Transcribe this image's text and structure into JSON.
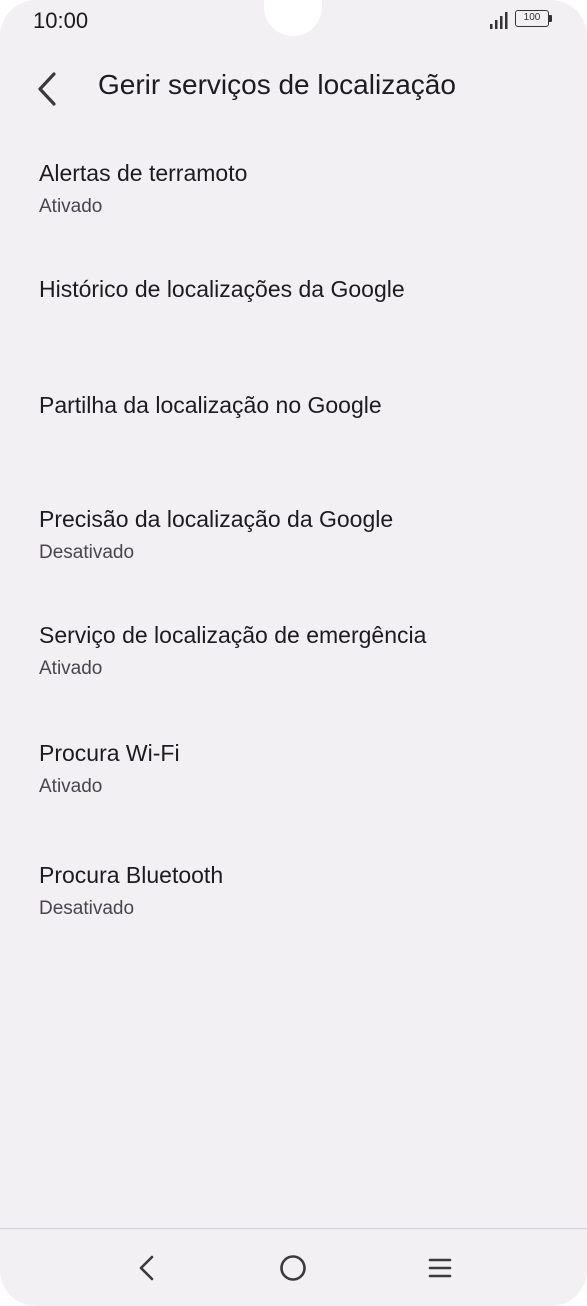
{
  "status_bar": {
    "time": "10:00",
    "battery_level": "100",
    "signal_icon": "signal-bars-icon",
    "battery_icon": "battery-icon"
  },
  "header": {
    "title": "Gerir serviços de localização",
    "back_icon": "chevron-left-icon"
  },
  "settings": [
    {
      "title": "Alertas de terramoto",
      "summary": "Ativado"
    },
    {
      "title": "Histórico de localizações da Google",
      "summary": ""
    },
    {
      "title": "Partilha da localização no Google",
      "summary": ""
    },
    {
      "title": "Precisão da localização da Google",
      "summary": "Desativado"
    },
    {
      "title": "Serviço de localização de emergência",
      "summary": "Ativado"
    },
    {
      "title": "Procura Wi-Fi",
      "summary": "Ativado"
    },
    {
      "title": "Procura Bluetooth",
      "summary": "Desativado"
    }
  ],
  "nav_bar": {
    "back_icon": "nav-back-icon",
    "home_icon": "nav-home-icon",
    "recents_icon": "nav-menu-icon"
  },
  "colors": {
    "background": "#f2f0f3",
    "text_primary": "#1c1b1f",
    "text_secondary": "#49454f"
  }
}
